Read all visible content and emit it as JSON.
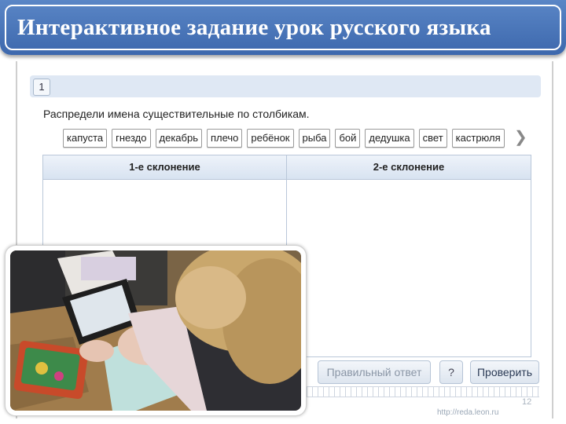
{
  "slide": {
    "title": "Интерактивное задание урок русского языка",
    "page_number": "12"
  },
  "task": {
    "number": "1",
    "instruction": "Распредели имена существительные по столбикам.",
    "words": [
      "капуста",
      "гнездо",
      "декабрь",
      "плечо",
      "ребёнок",
      "рыба",
      "бой",
      "дедушка",
      "свет",
      "кастрюля"
    ],
    "columns": [
      "1-е склонение",
      "2-е склонение"
    ],
    "buttons": {
      "correct_answer": "Правильный ответ",
      "help": "?",
      "check": "Проверить"
    },
    "watermark": "http://reda.leon.ru"
  },
  "photo": {
    "icon": "classroom-photo-icon"
  },
  "colors": {
    "title_bar": "#4a76ba",
    "header_strip": "#dfe8f4",
    "table_border": "#b9c7d9"
  }
}
